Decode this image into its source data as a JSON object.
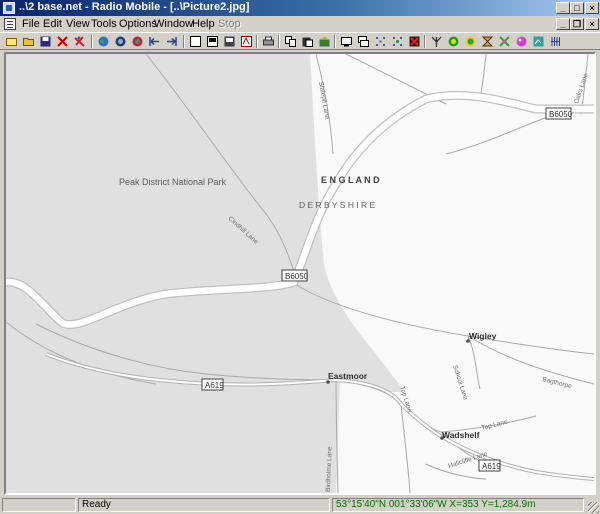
{
  "window": {
    "title": "..\\2 base.net - Radio Mobile - [..\\Picture2.jpg]",
    "controls": [
      "_",
      "□",
      "×"
    ]
  },
  "menu": {
    "items": [
      "File",
      "Edit",
      "View",
      "Tools",
      "Options",
      "Window",
      "Help",
      "Stop"
    ],
    "mdi_controls": [
      "_",
      "❐",
      "×"
    ]
  },
  "toolbar": {
    "icons": [
      "new-file-icon",
      "open-folder-icon",
      "save-icon",
      "scissors-tool-icon",
      "cut-red-icon",
      "globe-icon",
      "globe-network-icon",
      "radio-color-icon",
      "arrow-left-bar-icon",
      "arrow-right-bar-icon",
      "new-window-icon",
      "picture-window-icon",
      "save-picture-icon",
      "pdf-icon",
      "print-icon",
      "copy-icon",
      "paste-icon",
      "merge-icon",
      "display-icon",
      "stack-icon",
      "grid-select-icon",
      "grid-point-icon",
      "grid-cross-icon",
      "antenna-icon",
      "target-icon",
      "coverage-icon",
      "hourglass-icon",
      "cross-pink-icon",
      "sphere-pink-icon",
      "chart-window-icon",
      "signal-lines-icon"
    ]
  },
  "map": {
    "labels": {
      "park": "Peak District National Park",
      "country": "E N G L A N D",
      "county": "D E R B Y S H I R E",
      "b6050_top": "B6050",
      "b6050_mid": "B6050",
      "a619_left": "A619",
      "a619_right": "A619",
      "wigley": "Wigley",
      "eastmoor": "Eastmoor",
      "wadshelf": "Wadshelf",
      "slatepit_lane": "Slatepit Lane",
      "oaks_lane": "Oaks Lane",
      "cindhill_lane": "Cindhill Lane",
      "school_lane": "School Lane",
      "top_lane": "Top Lane",
      "top_lane2": "Top Lane",
      "bagthorpe": "Bagthorpe",
      "hallcliffe_lane": "Hallcliffe Lane",
      "birdholme_lane": "Birdholme Lane"
    },
    "colors": {
      "park_fill": "#e0e0e0",
      "land_fill": "#f9f9f9",
      "road": "#ffffff",
      "road_outline": "#b8b8b8",
      "lane": "#a8a8a8",
      "label": "#5a5a5a"
    }
  },
  "status": {
    "pane1": "",
    "pane2": "Ready",
    "coords": "53°15'40\"N 001°33'06\"W  X=353 Y=1,284.9m",
    "coords_color": "#007000"
  }
}
